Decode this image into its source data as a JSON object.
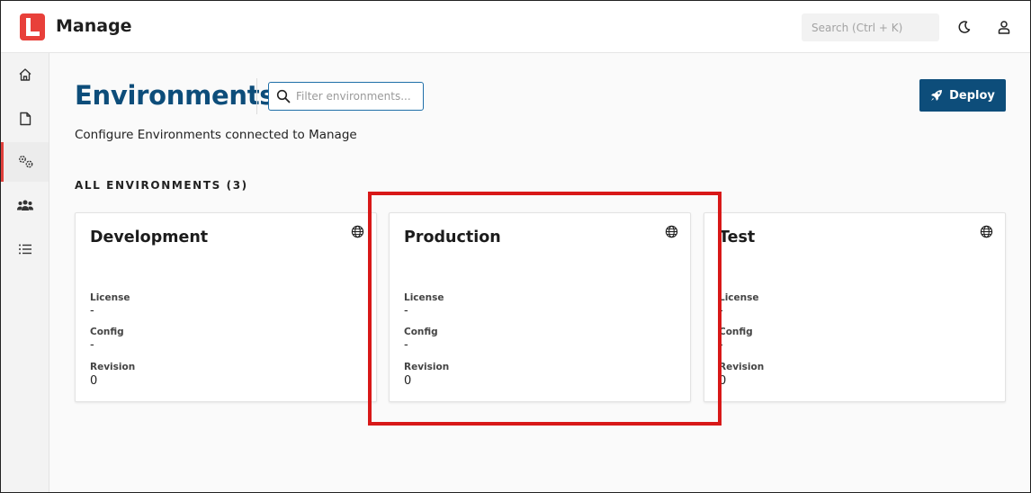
{
  "header": {
    "app_title": "Manage",
    "search_placeholder": "Search (Ctrl + K)",
    "logo_color": "#e8403a"
  },
  "sidebar": {
    "items": [
      {
        "name": "home-icon",
        "active": false
      },
      {
        "name": "document-icon",
        "active": false
      },
      {
        "name": "gears-icon",
        "active": true
      },
      {
        "name": "users-icon",
        "active": false
      },
      {
        "name": "list-icon",
        "active": false
      }
    ]
  },
  "main": {
    "title": "Environments",
    "filter_placeholder": "Filter environments...",
    "deploy_label": "Deploy",
    "subtitle": "Configure Environments connected to Manage",
    "section_heading": "ALL ENVIRONMENTS (3)"
  },
  "environments": [
    {
      "name": "Development",
      "license_label": "License",
      "license": "-",
      "config_label": "Config",
      "config": "-",
      "revision_label": "Revision",
      "revision": "0"
    },
    {
      "name": "Production",
      "license_label": "License",
      "license": "-",
      "config_label": "Config",
      "config": "-",
      "revision_label": "Revision",
      "revision": "0"
    },
    {
      "name": "Test",
      "license_label": "License",
      "license": "-",
      "config_label": "Config",
      "config": "-",
      "revision_label": "Revision",
      "revision": "0"
    }
  ],
  "colors": {
    "accent": "#0d4d7a",
    "highlight": "#d81818",
    "active_marker": "#e0403c"
  }
}
